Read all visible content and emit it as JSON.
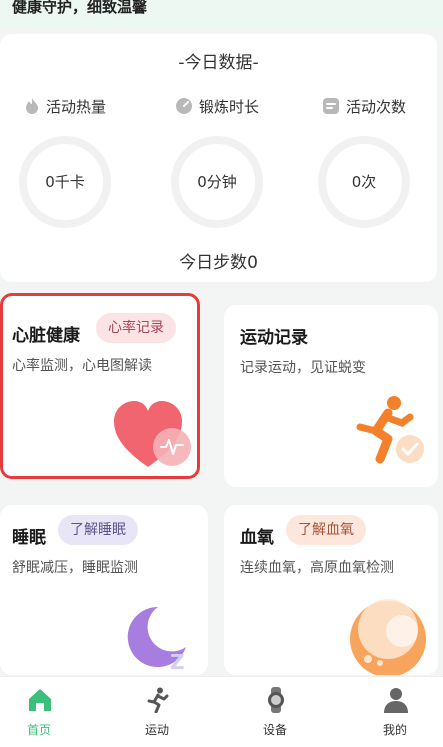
{
  "header": {
    "slogan": "健康守护，细致温馨"
  },
  "today": {
    "title": "-今日数据-",
    "stats": [
      {
        "label": "活动热量",
        "icon": "flame-icon",
        "value": "0千卡"
      },
      {
        "label": "锻炼时长",
        "icon": "timer-icon",
        "value": "0分钟"
      },
      {
        "label": "活动次数",
        "icon": "count-icon",
        "value": "0次"
      }
    ],
    "steps": "今日步数0"
  },
  "cards": [
    {
      "title": "心脏健康",
      "tag": "心率记录",
      "desc": "心率监测，心电图解读",
      "icon": "heart-icon"
    },
    {
      "title": "运动记录",
      "desc": "记录运动，见证蜕变",
      "icon": "runner-icon"
    },
    {
      "title": "睡眠",
      "tag": "了解睡眠",
      "desc": "舒眠减压，睡眠监测",
      "icon": "moon-icon"
    },
    {
      "title": "血氧",
      "tag": "了解血氧",
      "desc": "连续血氧，高原血氧检测",
      "icon": "oxygen-icon"
    }
  ],
  "tabbar": {
    "items": [
      {
        "label": "首页",
        "icon": "home-icon",
        "active": true
      },
      {
        "label": "运动",
        "icon": "run-icon"
      },
      {
        "label": "设备",
        "icon": "watch-icon"
      },
      {
        "label": "我的",
        "icon": "user-icon"
      }
    ]
  },
  "colors": {
    "accent": "#3bbf7a",
    "selection": "#e63b3b"
  }
}
